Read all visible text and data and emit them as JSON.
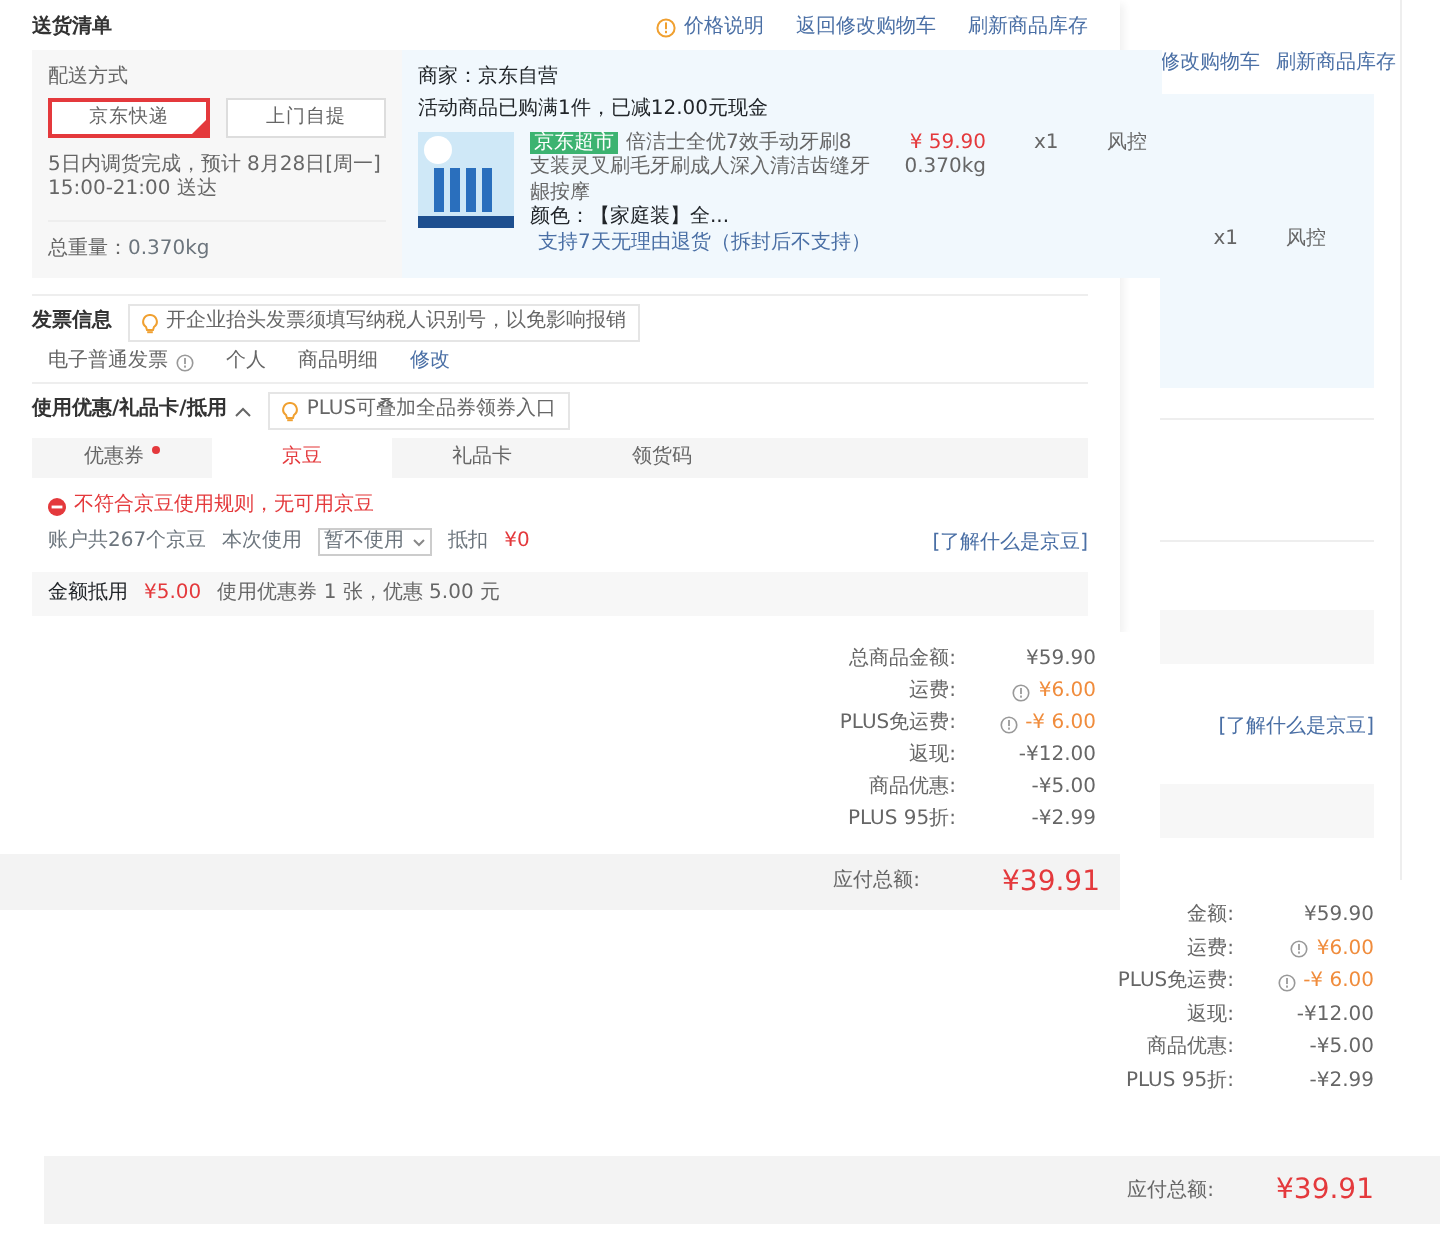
{
  "front": {
    "delivery": {
      "title": "送货清单",
      "links": [
        {
          "kind": "info",
          "text": "价格说明"
        },
        {
          "kind": "plain",
          "text": "返回修改购物车"
        },
        {
          "kind": "plain",
          "text": "刷新商品库存"
        }
      ],
      "shipping_label": "配送方式",
      "options": [
        {
          "label": "京东快递",
          "selected": true
        },
        {
          "label": "上门自提",
          "selected": false
        }
      ],
      "eta": "5日内调货完成，预计 8月28日[周一] 15:00-21:00 送达",
      "weight_label": "总重量：",
      "weight": "0.370kg",
      "seller": "商家：京东自营",
      "promo": "活动商品已购满1件，已减12.00元现金",
      "item": {
        "tag": "京东超市",
        "name": "倍洁士全优7效手动牙刷8支装灵叉刷毛牙刷成人深入清洁齿缝牙龈按摩",
        "variant": "颜色：【家庭装】全...",
        "service": "支持7天无理由退货（拆封后不支持）",
        "price": "¥ 59.90",
        "weight": "0.370kg",
        "qty": "x1",
        "status": "风控"
      }
    },
    "invoice": {
      "title": "发票信息",
      "tip": "开企业抬头发票须填写纳税人识别号，以免影响报销",
      "type": "电子普通发票",
      "person": "个人",
      "content": "商品明细",
      "edit": "修改"
    },
    "discounts": {
      "title": "使用优惠/礼品卡/抵用",
      "expanded": true,
      "tip": "PLUS可叠加全品券领券入口",
      "tabs": [
        {
          "label": "优惠券",
          "selected": false,
          "dot": true
        },
        {
          "label": "京豆",
          "selected": true,
          "dot": false
        },
        {
          "label": "礼品卡",
          "selected": false,
          "dot": false
        },
        {
          "label": "领货码",
          "selected": false,
          "dot": false
        }
      ],
      "error": "不符合京豆使用规则，无可用京豆",
      "account": "账户共267个京豆",
      "use_label": "本次使用",
      "select": "暂不使用",
      "deduct_label": "抵扣",
      "deduct": "¥0",
      "learn_link": "[了解什么是京豆]",
      "summary_label": "金额抵用",
      "summary_value": "¥5.00",
      "summary_text": "使用优惠券 1 张，优惠 5.00 元"
    },
    "totals": [
      {
        "label": "总商品金额:",
        "value": "¥59.90",
        "info": false,
        "kind": "plain"
      },
      {
        "label": "运费:",
        "value": "¥6.00",
        "info": true,
        "kind": "fee"
      },
      {
        "label": "PLUS免运费:",
        "value": "-¥ 6.00",
        "info": true,
        "kind": "fee"
      },
      {
        "label": "返现:",
        "value": "-¥12.00",
        "info": false,
        "kind": "plain"
      },
      {
        "label": "商品优惠:",
        "value": "-¥5.00",
        "info": false,
        "kind": "plain"
      },
      {
        "label": "PLUS 95折:",
        "value": "-¥2.99",
        "info": false,
        "kind": "plain"
      }
    ],
    "payable": {
      "label": "应付总额:",
      "value": "¥39.91"
    }
  },
  "back": {
    "links": [
      "修改购物车",
      "刷新商品库存"
    ],
    "qty": "x1",
    "status": "风控",
    "learn_link": "[了解什么是京豆]",
    "totals": [
      {
        "label": "金额:",
        "value": "¥59.90",
        "info": false,
        "kind": "plain"
      },
      {
        "label": "运费:",
        "value": "¥6.00",
        "info": true,
        "kind": "fee"
      },
      {
        "label": "PLUS免运费:",
        "value": "-¥ 6.00",
        "info": true,
        "kind": "fee"
      },
      {
        "label": "返现:",
        "value": "-¥12.00",
        "info": false,
        "kind": "plain"
      },
      {
        "label": "商品优惠:",
        "value": "-¥5.00",
        "info": false,
        "kind": "plain"
      },
      {
        "label": "PLUS 95折:",
        "value": "-¥2.99",
        "info": false,
        "kind": "plain"
      }
    ],
    "payable": {
      "label": "应付总额:",
      "value": "¥39.91"
    }
  }
}
